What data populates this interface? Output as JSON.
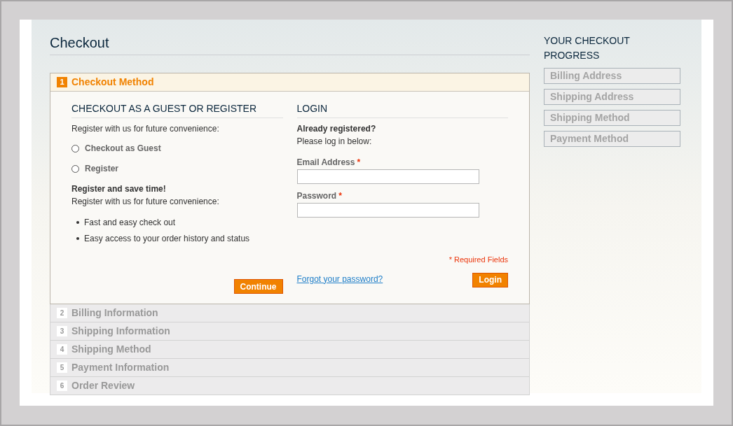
{
  "page_title": "Checkout",
  "steps": [
    {
      "number": "1",
      "title": "Checkout Method",
      "active": true
    },
    {
      "number": "2",
      "title": "Billing Information",
      "active": false
    },
    {
      "number": "3",
      "title": "Shipping Information",
      "active": false
    },
    {
      "number": "4",
      "title": "Shipping Method",
      "active": false
    },
    {
      "number": "5",
      "title": "Payment Information",
      "active": false
    },
    {
      "number": "6",
      "title": "Order Review",
      "active": false
    }
  ],
  "guest_section": {
    "heading": "CHECKOUT AS A GUEST OR REGISTER",
    "intro": "Register with us for future convenience:",
    "options": [
      {
        "label": "Checkout as Guest",
        "selected": false
      },
      {
        "label": "Register",
        "selected": false
      }
    ],
    "benefits_title": "Register and save time!",
    "benefits_intro": "Register with us for future convenience:",
    "benefits": [
      "Fast and easy check out",
      "Easy access to your order history and status"
    ],
    "continue_button": "Continue"
  },
  "login_section": {
    "heading": "LOGIN",
    "subtitle": "Already registered?",
    "intro": "Please log in below:",
    "fields": [
      {
        "label": "Email Address",
        "required_mark": "*"
      },
      {
        "label": "Password",
        "required_mark": "*"
      }
    ],
    "required_note": "* Required Fields",
    "forgot_link": "Forgot your password?",
    "login_button": "Login"
  },
  "progress": {
    "title": "YOUR CHECKOUT PROGRESS",
    "items": [
      "Billing Address",
      "Shipping Address",
      "Shipping Method",
      "Payment Method"
    ]
  }
}
